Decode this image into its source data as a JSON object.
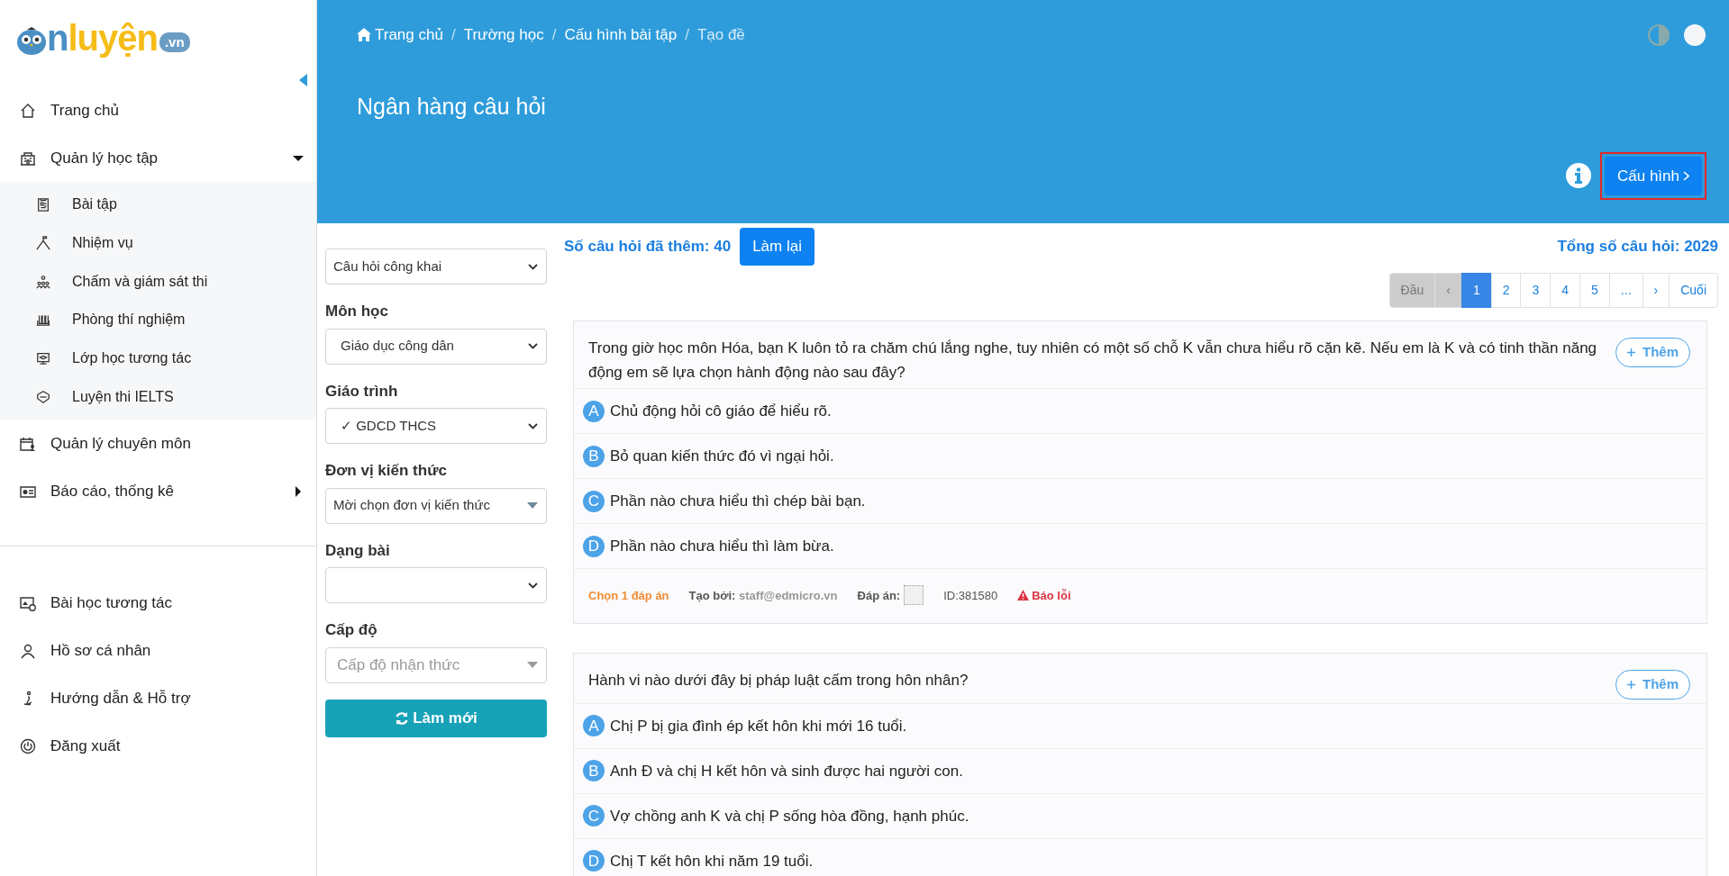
{
  "logo": {
    "prefix": "n",
    "word": "luyện",
    "domain": ".vn"
  },
  "sidebar": {
    "main_items": [
      {
        "label": "Trang chủ"
      },
      {
        "label": "Quản lý học tập",
        "expanded": true,
        "children": [
          {
            "label": "Bài tập"
          },
          {
            "label": "Nhiệm vụ"
          },
          {
            "label": "Chấm và giám sát thi"
          },
          {
            "label": "Phòng thí nghiệm"
          },
          {
            "label": "Lớp học tương tác"
          },
          {
            "label": "Luyện thi IELTS"
          }
        ]
      },
      {
        "label": "Quản lý chuyên môn"
      },
      {
        "label": "Báo cáo, thống kê",
        "expanded": false
      }
    ],
    "lower_items": [
      {
        "label": "Bài học tương tác"
      },
      {
        "label": "Hồ sơ cá nhân"
      },
      {
        "label": "Hướng dẫn & Hỗ trợ"
      },
      {
        "label": "Đăng xuất"
      }
    ]
  },
  "breadcrumb": [
    {
      "label": "Trang chủ",
      "selected": false
    },
    {
      "label": "Trường học",
      "selected": false
    },
    {
      "label": "Cấu hình bài tập",
      "selected": false
    },
    {
      "label": "Tạo đề",
      "selected": true
    }
  ],
  "breadcrumb_separator": "/",
  "page_title": "Ngân hàng câu hỏi",
  "config_button": {
    "label": "Cấu hình",
    "highlighted": true
  },
  "filters": {
    "source": "Câu hỏi công khai",
    "fields": [
      {
        "label": "Môn học",
        "kind": "select",
        "value": "Giáo dục công dân"
      },
      {
        "label": "Giáo trình",
        "kind": "select",
        "value": "✓ GDCD THCS"
      },
      {
        "label": "Đơn vị kiến thức",
        "kind": "combo",
        "value": "Mời chọn đơn vị kiến thức"
      },
      {
        "label": "Dạng bài",
        "kind": "select"
      },
      {
        "label": "Cấp độ",
        "kind": "combo",
        "placeholder": "Cấp độ nhận thức"
      }
    ],
    "refresh_button": "Làm mới"
  },
  "added_count": "Số câu hỏi đã thêm: 40",
  "reset_button": "Làm lại",
  "total_count": "Tổng số câu hỏi: 2029",
  "pagination": [
    {
      "label": "Đầu",
      "selected": false,
      "disabled": true
    },
    {
      "label": "‹",
      "selected": false,
      "disabled": true
    },
    {
      "label": "1",
      "selected": true,
      "disabled": false
    },
    {
      "label": "2",
      "selected": false,
      "disabled": false
    },
    {
      "label": "3",
      "selected": false,
      "disabled": false
    },
    {
      "label": "4",
      "selected": false,
      "disabled": false
    },
    {
      "label": "5",
      "selected": false,
      "disabled": false
    },
    {
      "label": "...",
      "selected": false,
      "disabled": false
    },
    {
      "label": "›",
      "selected": false,
      "disabled": false
    },
    {
      "label": "Cuối",
      "selected": false,
      "disabled": false
    }
  ],
  "questions": [
    {
      "text": "Trong giờ học môn Hóa, bạn K luôn tỏ ra chăm chú lắng nghe, tuy nhiên có một số chỗ K vẫn chưa hiểu rõ cặn kẽ. Nếu em là K và có tinh thần năng động em sẽ lựa chọn hành động nào sau đây?",
      "add_button": "Thêm",
      "options": [
        {
          "letter": "A",
          "text": "Chủ động hỏi cô giáo để hiểu rõ."
        },
        {
          "letter": "B",
          "text": "Bỏ quan kiến thức đó vì ngại hỏi."
        },
        {
          "letter": "C",
          "text": "Phần nào chưa hiểu thì chép bài bạn."
        },
        {
          "letter": "D",
          "text": "Phần nào chưa hiểu thì làm bừa."
        }
      ],
      "meta": {
        "type": "Chọn 1 đáp án",
        "author_label": "Tạo bởi:",
        "author": "staff@edmicro.vn",
        "answer_label": "Đáp án:",
        "id": "ID:381580",
        "report": "Báo lỗi"
      }
    },
    {
      "text": "Hành vi nào dưới đây bị pháp luật cấm trong hôn nhân?",
      "add_button": "Thêm",
      "options": [
        {
          "letter": "A",
          "text": "Chị P bị gia đình ép kết hôn khi mới 16 tuổi."
        },
        {
          "letter": "B",
          "text": "Anh Đ và chị H kết hôn và sinh được hai người con."
        },
        {
          "letter": "C",
          "text": "Vợ chồng anh K và chị P sống hòa đồng, hạnh phúc."
        },
        {
          "letter": "D",
          "text": "Chị T kết hôn khi năm 19 tuổi."
        }
      ]
    }
  ]
}
